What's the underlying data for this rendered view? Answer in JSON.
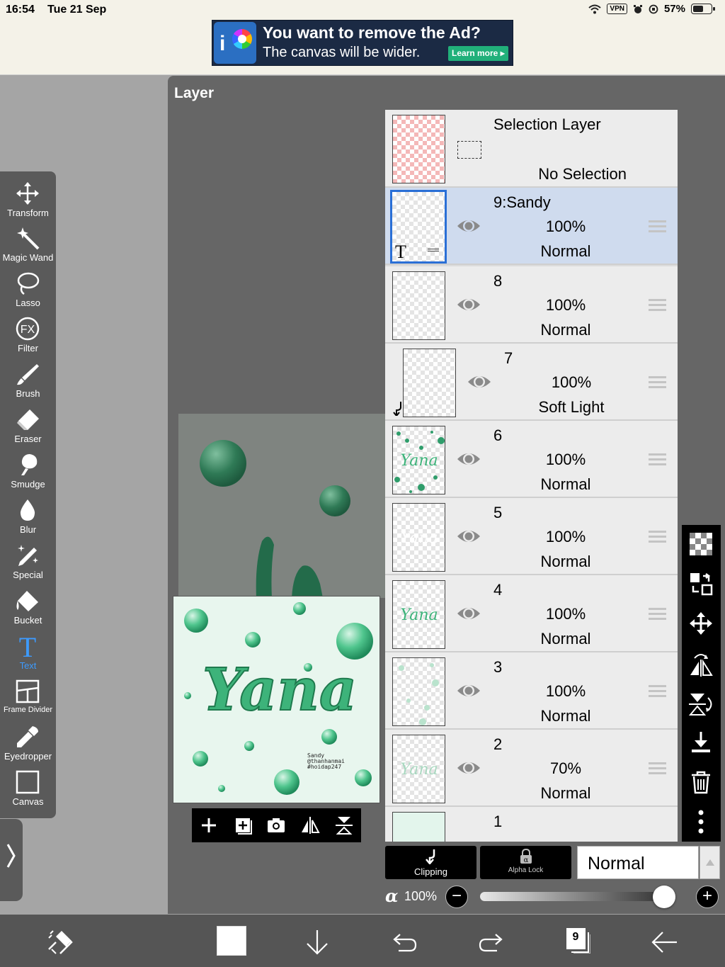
{
  "status_bar": {
    "time": "16:54",
    "date": "Tue 21 Sep",
    "vpn": "VPN",
    "battery": "57%"
  },
  "ad": {
    "title": "You want to remove the Ad?",
    "subtitle": "The canvas will be wider.",
    "cta": "Learn more"
  },
  "panel": {
    "title": "Layer"
  },
  "tools": [
    {
      "label": "Transform",
      "icon": "move-arrows-icon"
    },
    {
      "label": "Magic Wand",
      "icon": "magic-wand-icon"
    },
    {
      "label": "Lasso",
      "icon": "lasso-icon"
    },
    {
      "label": "Filter",
      "icon": "fx-icon"
    },
    {
      "label": "Brush",
      "icon": "brush-icon"
    },
    {
      "label": "Eraser",
      "icon": "eraser-icon"
    },
    {
      "label": "Smudge",
      "icon": "smudge-icon"
    },
    {
      "label": "Blur",
      "icon": "drop-icon"
    },
    {
      "label": "Special",
      "icon": "sparkle-pen-icon"
    },
    {
      "label": "Bucket",
      "icon": "bucket-icon"
    },
    {
      "label": "Text",
      "icon": "text-t-icon"
    },
    {
      "label": "Frame Divider",
      "icon": "frame-divider-icon"
    },
    {
      "label": "Eyedropper",
      "icon": "eyedropper-icon"
    },
    {
      "label": "Canvas",
      "icon": "canvas-square-icon"
    }
  ],
  "active_tool": "Text",
  "selection_layer": {
    "title": "Selection Layer",
    "status": "No Selection"
  },
  "layers": [
    {
      "name": "9:Sandy",
      "opacity": "100%",
      "mode": "Normal"
    },
    {
      "name": "8",
      "opacity": "100%",
      "mode": "Normal"
    },
    {
      "name": "7",
      "opacity": "100%",
      "mode": "Soft Light"
    },
    {
      "name": "6",
      "opacity": "100%",
      "mode": "Normal"
    },
    {
      "name": "5",
      "opacity": "100%",
      "mode": "Normal"
    },
    {
      "name": "4",
      "opacity": "100%",
      "mode": "Normal"
    },
    {
      "name": "3",
      "opacity": "100%",
      "mode": "Normal"
    },
    {
      "name": "2",
      "opacity": "70%",
      "mode": "Normal"
    },
    {
      "name": "1",
      "opacity": "",
      "mode": ""
    }
  ],
  "thumb_text": {
    "word": "Yana",
    "credit_line1": "Sandy",
    "credit_line2": "@thanhanmai",
    "credit_line3": "#hoidap247"
  },
  "thumb_tools": [
    "add-icon",
    "add-layer-icon",
    "camera-icon",
    "flip-horizontal-icon",
    "flip-vertical-icon"
  ],
  "right_tools": [
    "checkerboard-icon",
    "transfer-icon",
    "move-icon",
    "flip-horizontal-icon",
    "flip-vertical-icon",
    "download-icon",
    "trash-icon",
    "more-icon"
  ],
  "blend": {
    "clipping": "Clipping",
    "alpha_lock": "Alpha Lock",
    "mode": "Normal"
  },
  "opacity": {
    "symbol": "α",
    "value": "100%",
    "level": 1.0,
    "minus": "−",
    "plus": "+"
  },
  "bottom_nav": {
    "layer_count": "9",
    "color": "#ffffff"
  },
  "colors": {
    "accent": "#3d9bff",
    "selected_row": "#cfdbee",
    "panel_bg": "#666666"
  }
}
